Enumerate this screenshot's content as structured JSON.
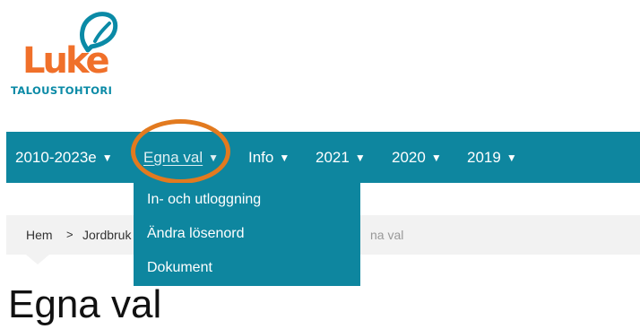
{
  "logo": {
    "word": "Luke",
    "subtitle": "TALOUSTOHTORI",
    "colors": {
      "orange": "#f0702a",
      "teal": "#0a8aa6"
    }
  },
  "nav": {
    "items": [
      {
        "label": "2010-2023e"
      },
      {
        "label": "Egna val",
        "active": true
      },
      {
        "label": "Info"
      },
      {
        "label": "2021"
      },
      {
        "label": "2020"
      },
      {
        "label": "2019"
      }
    ],
    "caret_icon": "caret-down-icon",
    "background": "#0e869f",
    "highlight_color": "#e27a1f"
  },
  "dropdown": {
    "items": [
      "In- och utloggning",
      "Ändra lösenord",
      "Dokument"
    ]
  },
  "breadcrumb": {
    "home": "Hem",
    "separator": ">",
    "second_partial": "Jordbruk",
    "current_partial": "na val"
  },
  "page": {
    "title": "Egna val"
  }
}
